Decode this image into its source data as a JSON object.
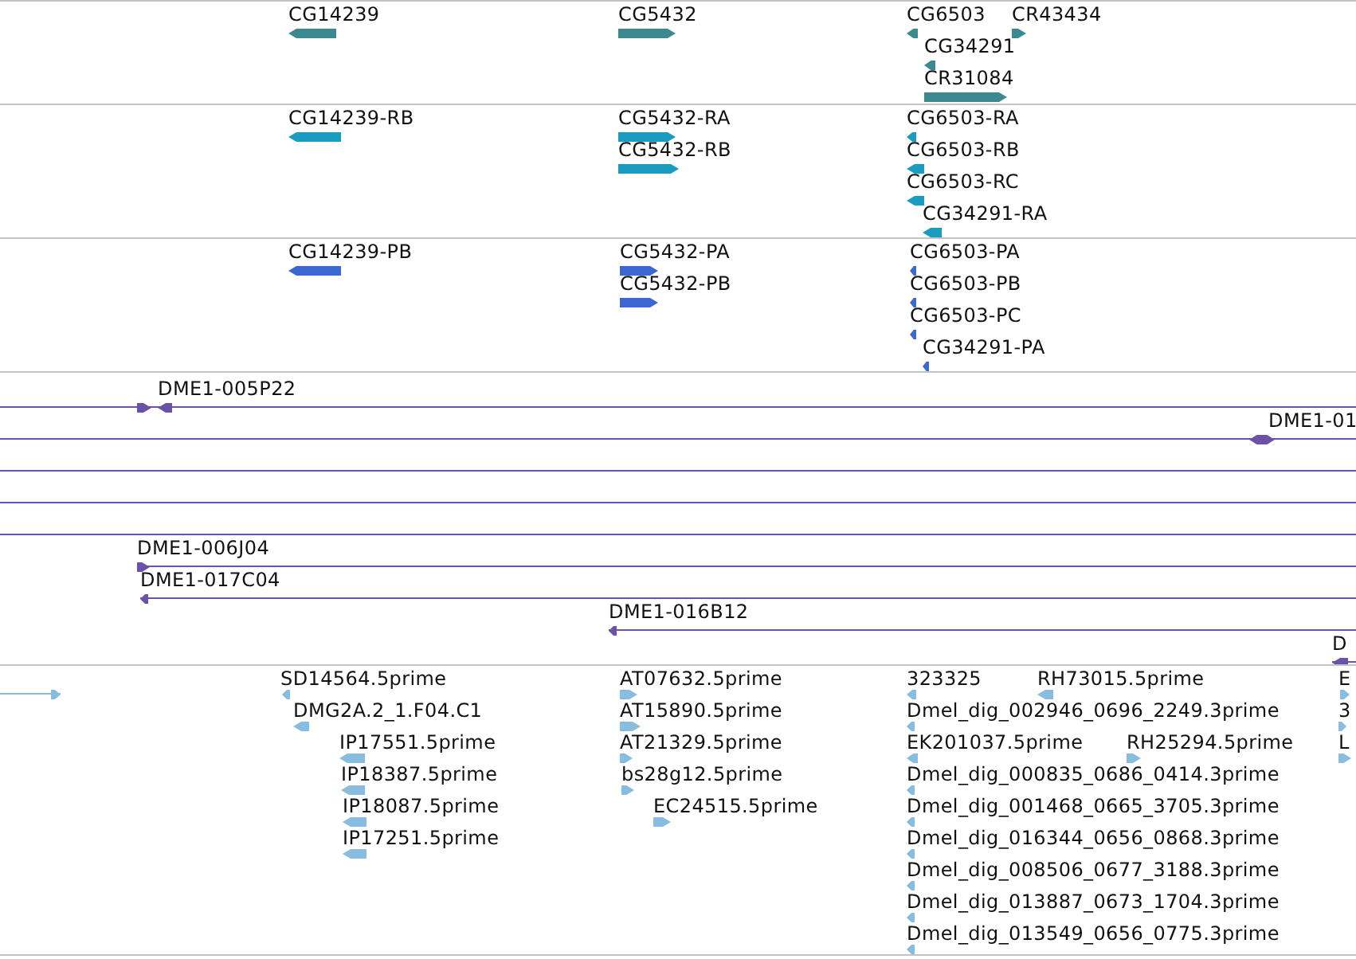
{
  "tracks": [
    {
      "kind": "gene",
      "color": "#3c8a90",
      "features": [
        {
          "label": "CG14239",
          "reverse": true
        },
        {
          "label": "CG5432",
          "reverse": false
        },
        {
          "label": "CG6503",
          "reverse": true
        },
        {
          "label": "CR43434",
          "reverse": false
        },
        {
          "label": "CG34291",
          "reverse": true
        },
        {
          "label": "CR31084",
          "reverse": false
        }
      ]
    },
    {
      "kind": "transcript",
      "color": "#1a9cc0",
      "features": [
        {
          "label": "CG14239-RB",
          "reverse": true
        },
        {
          "label": "CG5432-RA",
          "reverse": false
        },
        {
          "label": "CG5432-RB",
          "reverse": false
        },
        {
          "label": "CG6503-RA",
          "reverse": true
        },
        {
          "label": "CG6503-RB",
          "reverse": true
        },
        {
          "label": "CG6503-RC",
          "reverse": true
        },
        {
          "label": "CG34291-RA",
          "reverse": true
        }
      ]
    },
    {
      "kind": "protein",
      "color": "#3a68d0",
      "features": [
        {
          "label": "CG14239-PB",
          "reverse": true
        },
        {
          "label": "CG5432-PA",
          "reverse": false
        },
        {
          "label": "CG5432-PB",
          "reverse": false
        },
        {
          "label": "CG6503-PA",
          "reverse": true
        },
        {
          "label": "CG6503-PB",
          "reverse": true
        },
        {
          "label": "CG6503-PC",
          "reverse": true
        },
        {
          "label": "CG34291-PA",
          "reverse": true
        }
      ]
    },
    {
      "kind": "clone",
      "color": "#6a52a8",
      "features": [
        {
          "kind": "arrow",
          "reverse": false
        },
        {
          "kind": "arrow",
          "label": "DME1-005P22",
          "reverse": true
        },
        {
          "kind": "arrow",
          "reverse": true
        },
        {
          "kind": "arrow",
          "label": "DME1-01",
          "reverse": false
        },
        {
          "kind": "line"
        },
        {
          "kind": "line"
        },
        {
          "kind": "line"
        },
        {
          "kind": "arrow",
          "label": "DME1-006J04",
          "reverse": false
        },
        {
          "kind": "arrow",
          "label": "DME1-017C04",
          "reverse": true
        },
        {
          "kind": "arrow",
          "label": "DME1-016B12",
          "reverse": true
        },
        {
          "kind": "arrow",
          "label": "D",
          "reverse": true
        }
      ]
    },
    {
      "kind": "est",
      "color": "#88bde0",
      "features": [
        {
          "reverse": false
        },
        {
          "label": "SD14564.5prime",
          "reverse": true
        },
        {
          "label": "DMG2A.2_1.F04.C1",
          "reverse": true
        },
        {
          "label": "IP17551.5prime",
          "reverse": true
        },
        {
          "label": "IP18387.5prime",
          "reverse": true
        },
        {
          "label": "IP18087.5prime",
          "reverse": true
        },
        {
          "label": "IP17251.5prime",
          "reverse": true
        },
        {
          "label": "AT07632.5prime",
          "reverse": false
        },
        {
          "label": "AT15890.5prime",
          "reverse": false
        },
        {
          "label": "AT21329.5prime",
          "reverse": false
        },
        {
          "label": "bs28g12.5prime",
          "reverse": false
        },
        {
          "label": "EC24515.5prime",
          "reverse": false
        },
        {
          "label": "323325",
          "reverse": true
        },
        {
          "label": "RH73015.5prime",
          "reverse": true
        },
        {
          "label": "Dmel_dig_002946_0696_2249.3prime",
          "reverse": true
        },
        {
          "label": "EK201037.5prime",
          "reverse": true
        },
        {
          "label": "RH25294.5prime",
          "reverse": false
        },
        {
          "label": "Dmel_dig_000835_0686_0414.3prime",
          "reverse": true
        },
        {
          "label": "Dmel_dig_001468_0665_3705.3prime",
          "reverse": true
        },
        {
          "label": "Dmel_dig_016344_0656_0868.3prime",
          "reverse": true
        },
        {
          "label": "Dmel_dig_008506_0677_3188.3prime",
          "reverse": true
        },
        {
          "label": "Dmel_dig_013887_0673_1704.3prime",
          "reverse": true
        },
        {
          "label": "Dmel_dig_013549_0656_0775.3prime",
          "reverse": true
        },
        {
          "label": "E",
          "reverse": false
        },
        {
          "label": "3",
          "reverse": false
        },
        {
          "label": "L",
          "reverse": false
        }
      ]
    }
  ]
}
